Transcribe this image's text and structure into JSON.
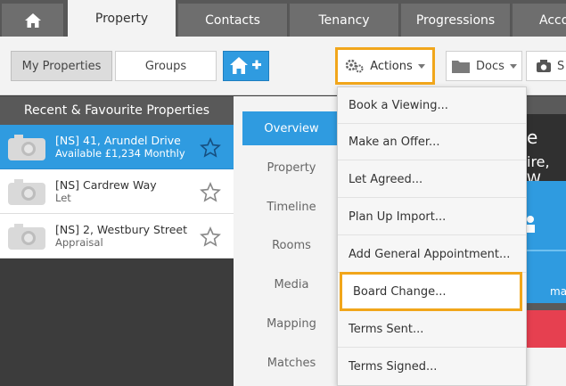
{
  "topnav": {
    "tabs": [
      {
        "label": "Property"
      },
      {
        "label": "Contacts"
      },
      {
        "label": "Tenancy"
      },
      {
        "label": "Progressions"
      },
      {
        "label": "Acco"
      }
    ]
  },
  "toolbar": {
    "my_properties": "My Properties",
    "groups": "Groups",
    "actions": "Actions",
    "docs": "Docs",
    "partial": "S"
  },
  "left_panel": {
    "header": "Recent & Favourite Properties",
    "properties": [
      {
        "title": "[NS] 41, Arundel Drive",
        "subtitle": "Available £1,234 Monthly"
      },
      {
        "title": "[NS] Cardrew Way",
        "subtitle": "Let"
      },
      {
        "title": "[NS] 2, Westbury Street",
        "subtitle": "Appraisal"
      }
    ]
  },
  "mid_nav": {
    "items": [
      {
        "label": "Overview"
      },
      {
        "label": "Property"
      },
      {
        "label": "Timeline"
      },
      {
        "label": "Rooms"
      },
      {
        "label": "Media"
      },
      {
        "label": "Mapping"
      },
      {
        "label": "Matches"
      }
    ]
  },
  "dropdown": {
    "items": [
      {
        "label": "Book a Viewing..."
      },
      {
        "label": "Make an Offer..."
      },
      {
        "label": "Let Agreed..."
      },
      {
        "label": "Plan Up Import..."
      },
      {
        "label": "Add General Appointment..."
      },
      {
        "label": "Board Change..."
      },
      {
        "label": "Terms Sent..."
      },
      {
        "label": "Terms Signed..."
      }
    ]
  },
  "right_partial": {
    "line1": "e",
    "line2": "ire, W",
    "line3": "ma"
  },
  "colors": {
    "accent": "#2f9be0",
    "highlight": "#f1a61b",
    "nav_bg": "#585858"
  }
}
